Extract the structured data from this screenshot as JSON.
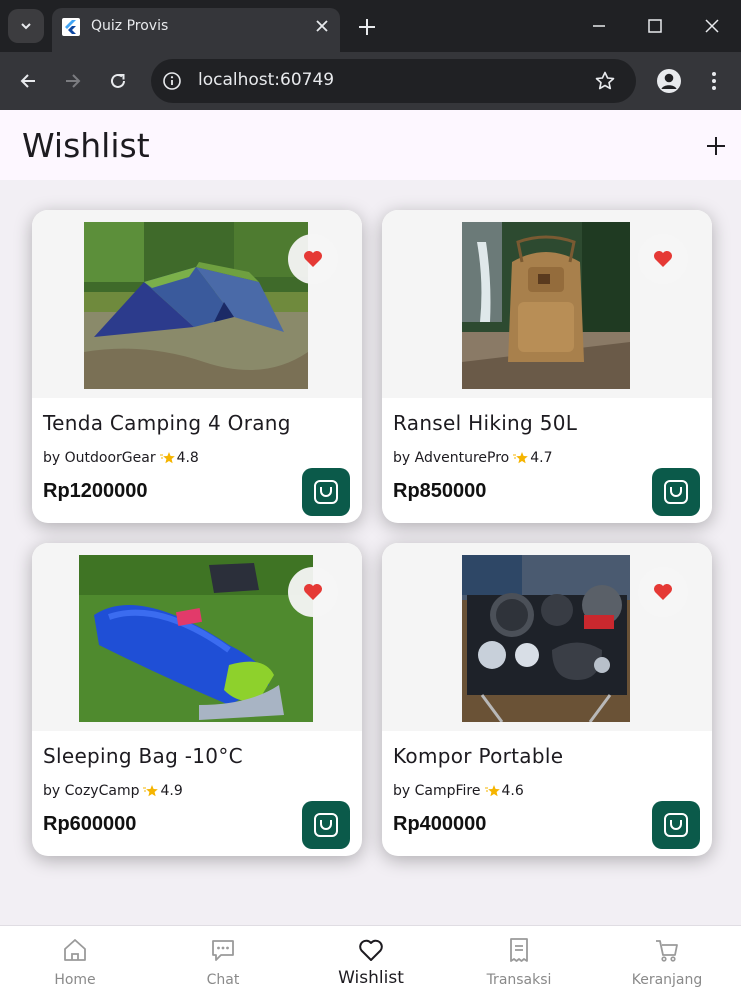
{
  "browser": {
    "tab_title": "Quiz Provis",
    "url": "localhost:60749"
  },
  "appbar": {
    "title": "Wishlist"
  },
  "colors": {
    "accent": "#0b5a4a",
    "heart": "#e53935",
    "star": "#f5b400"
  },
  "products": [
    {
      "name": "Tenda Camping 4 Orang",
      "by": "by OutdoorGear",
      "rating": "4.8",
      "price": "Rp1200000",
      "image": "tent-photo"
    },
    {
      "name": "Ransel Hiking 50L",
      "by": "by AdventurePro",
      "rating": "4.7",
      "price": "Rp850000",
      "image": "backpack-photo"
    },
    {
      "name": "Sleeping Bag -10°C",
      "by": "by CozyCamp",
      "rating": "4.9",
      "price": "Rp600000",
      "image": "sleeping-bag-photo"
    },
    {
      "name": "Kompor Portable",
      "by": "by CampFire",
      "rating": "4.6",
      "price": "Rp400000",
      "image": "stove-photo"
    }
  ],
  "bottom_nav": [
    {
      "label": "Home",
      "icon": "home-icon"
    },
    {
      "label": "Chat",
      "icon": "chat-icon"
    },
    {
      "label": "Wishlist",
      "icon": "heart-outline-icon",
      "active": true
    },
    {
      "label": "Transaksi",
      "icon": "receipt-icon"
    },
    {
      "label": "Keranjang",
      "icon": "cart-icon"
    }
  ]
}
